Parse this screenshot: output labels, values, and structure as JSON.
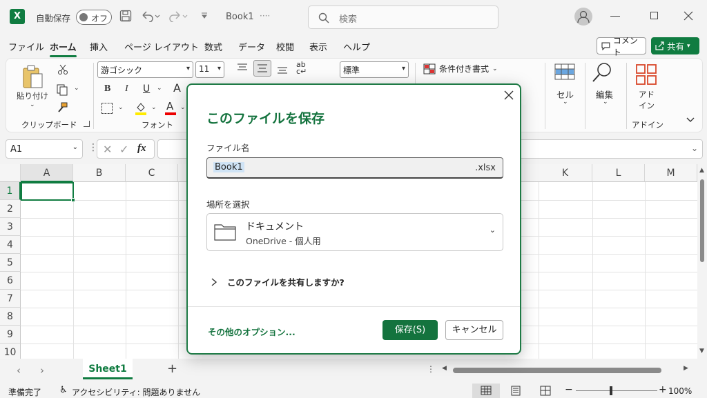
{
  "titlebar": {
    "app_logo": "X",
    "autosave_label": "自動保存",
    "autosave_state": "オフ",
    "doc_title": "Book1",
    "doc_title_suffix": "····",
    "search_placeholder": "検索"
  },
  "menu": {
    "tabs": [
      "ファイル",
      "ホーム",
      "挿入",
      "ページ レイアウト",
      "数式",
      "データ",
      "校閲",
      "表示",
      "ヘルプ"
    ],
    "active_index": 1,
    "comment_button": "コメント",
    "share_button": "共有"
  },
  "ribbon": {
    "paste_label": "貼り付け",
    "clipboard_group": "クリップボード",
    "font_name": "游ゴシック",
    "font_size": "11",
    "font_group": "フォント",
    "bold": "B",
    "italic": "I",
    "underline": "U",
    "grow_font": "A",
    "font_color": "A",
    "number_format": "標準",
    "conditional_format": "条件付き書式",
    "cells_label": "セル",
    "edit_label": "編集",
    "addin_label_1": "アド",
    "addin_label_2": "イン",
    "addin_group": "アドイン"
  },
  "formula_bar": {
    "name_box": "A1",
    "fx": "fx"
  },
  "grid": {
    "left_columns": [
      "A",
      "B",
      "C"
    ],
    "right_columns": [
      "K",
      "L",
      "M"
    ],
    "rows": [
      "1",
      "2",
      "3",
      "4",
      "5",
      "6",
      "7",
      "8",
      "9",
      "10"
    ]
  },
  "sheets": {
    "tabs": [
      "Sheet1"
    ],
    "add": "+"
  },
  "status": {
    "ready": "準備完了",
    "accessibility": "アクセシビリティ: 問題ありません",
    "zoom": "100%"
  },
  "dialog": {
    "title": "このファイルを保存",
    "filename_label": "ファイル名",
    "filename": "Book1",
    "extension": ".xlsx",
    "location_label": "場所を選択",
    "location_name": "ドキュメント",
    "location_sub": "OneDrive - 個人用",
    "share_prompt": "このファイルを共有しますか?",
    "more_options": "その他のオプション...",
    "save_button": "保存(S)",
    "cancel_button": "キャンセル"
  },
  "colors": {
    "accent": "#107c41",
    "dialog_accent": "#14733e"
  }
}
